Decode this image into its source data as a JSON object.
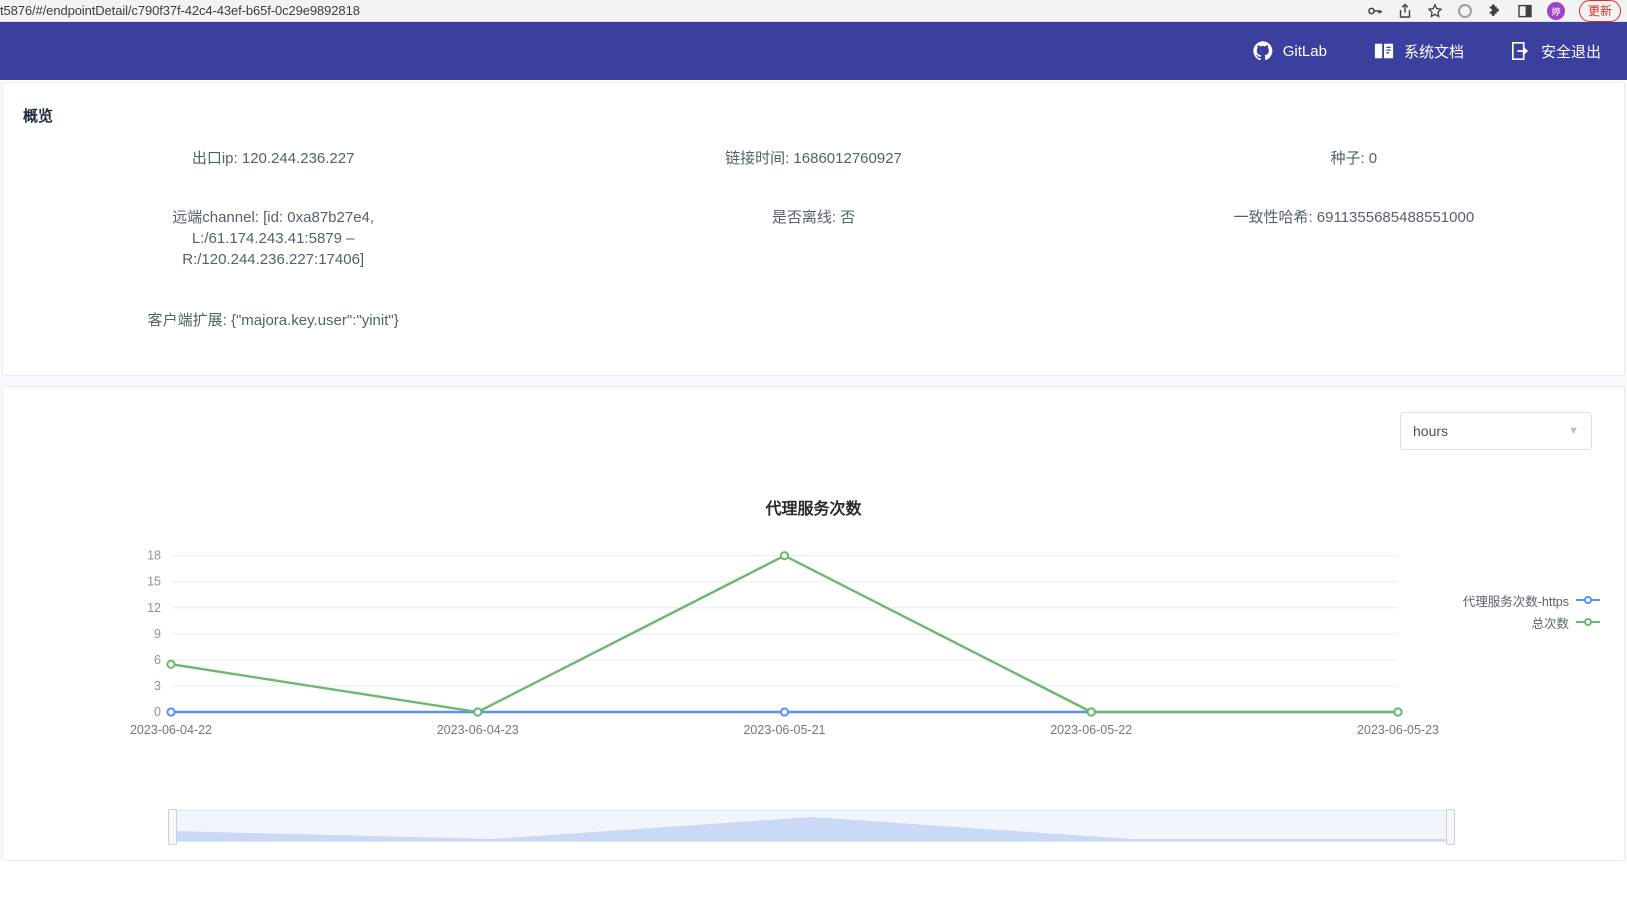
{
  "browser": {
    "url": "t5876/#/endpointDetail/c790f37f-42c4-43ef-b65f-0c29e9892818",
    "avatar_initial": "婷",
    "update_label": "更新"
  },
  "header": {
    "nav": [
      {
        "label": "GitLab",
        "icon": "github-icon"
      },
      {
        "label": "系统文档",
        "icon": "book-icon"
      },
      {
        "label": "安全退出",
        "icon": "logout-icon"
      }
    ],
    "background": "#3b3f9e"
  },
  "overview": {
    "title": "概览",
    "fields": {
      "exit_ip": "出口ip: 120.244.236.227",
      "link_time": "链接时间: 1686012760927",
      "seed": "种子: 0",
      "remote_channel_l1": "远端channel: [id: 0xa87b27e4,",
      "remote_channel_l2": "L:/61.174.243.41:5879 –",
      "remote_channel_l3": "R:/120.244.236.227:17406]",
      "offline": "是否离线: 否",
      "consistent_hash": "一致性哈希: 6911355685488551000",
      "client_ext": "客户端扩展: {\"majora.key.user\":\"yinit\"}"
    }
  },
  "chart_panel": {
    "granularity_select": {
      "value": "hours",
      "arrow": "▼"
    }
  },
  "chart_data": {
    "type": "line",
    "title": "代理服务次数",
    "xlabel": "",
    "ylabel": "",
    "categories": [
      "2023-06-04-22",
      "2023-06-04-23",
      "2023-06-05-21",
      "2023-06-05-22",
      "2023-06-05-23"
    ],
    "yticks": [
      0,
      3,
      6,
      9,
      12,
      15,
      18
    ],
    "ylim": [
      0,
      19
    ],
    "grid": true,
    "legend_position": "right",
    "series": [
      {
        "name": "代理服务次数-https",
        "color": "#5b8ff9",
        "values": [
          0,
          0,
          0,
          0,
          0
        ]
      },
      {
        "name": "总次数",
        "color": "#6cb86c",
        "values": [
          5.5,
          0,
          18,
          0,
          0
        ]
      }
    ]
  }
}
